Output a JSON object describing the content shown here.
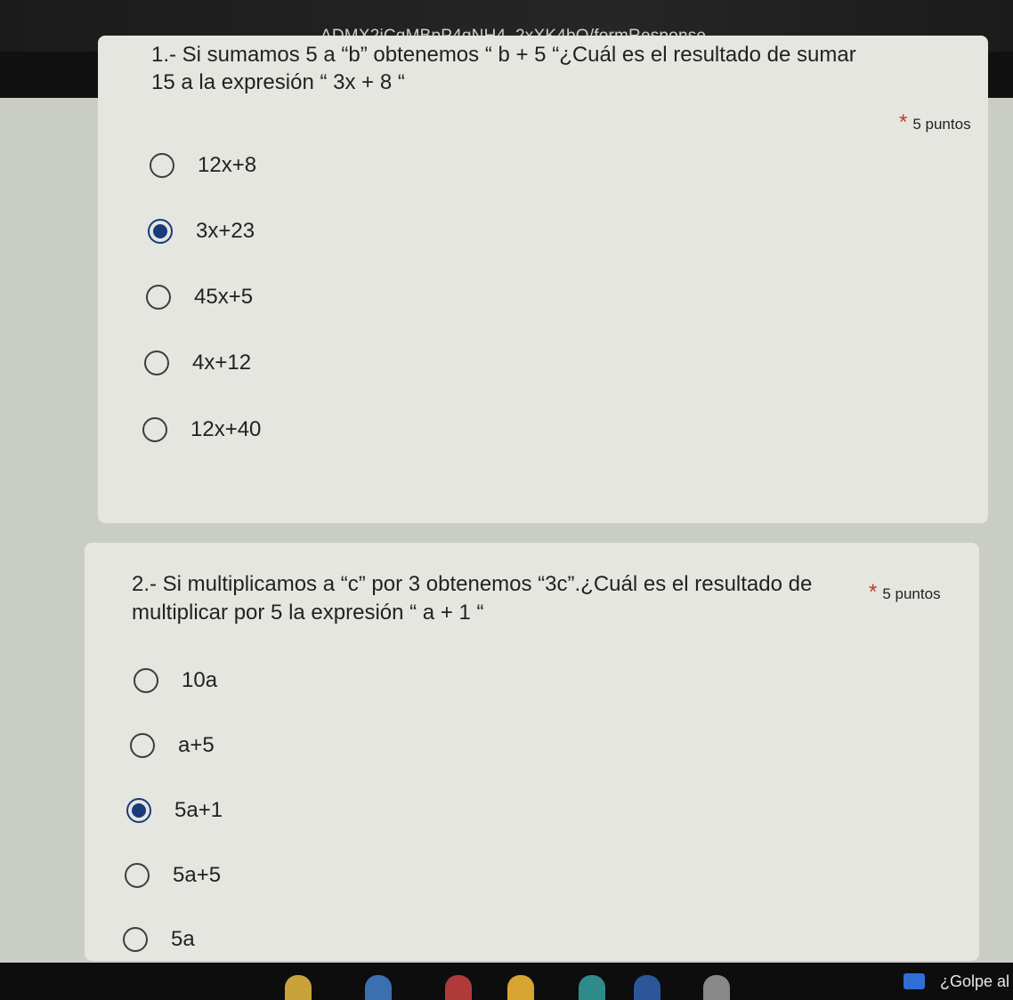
{
  "browser": {
    "url_fragment": "ADMX2iCqMBpP4qNH4_2xXK4bQ/formResponse"
  },
  "question1": {
    "line1": "1.- Si sumamos 5 a “b” obtenemos “ b + 5 “¿Cuál es el resultado de sumar",
    "line2": "15 a la expresión “ 3x + 8 “",
    "required": "*",
    "points": "5 puntos",
    "options": [
      {
        "label": "12x+8",
        "selected": false
      },
      {
        "label": "3x+23",
        "selected": true
      },
      {
        "label": "45x+5",
        "selected": false
      },
      {
        "label": "4x+12",
        "selected": false
      },
      {
        "label": "12x+40",
        "selected": false
      }
    ]
  },
  "question2": {
    "line1": "2.- Si multiplicamos a “c” por 3 obtenemos “3c”.¿Cuál es el resultado de",
    "line2": "multiplicar por 5 la expresión “ a + 1 “",
    "required": "*",
    "points": "5 puntos",
    "options": [
      {
        "label": "10a",
        "selected": false
      },
      {
        "label": "a+5",
        "selected": false
      },
      {
        "label": "5a+1",
        "selected": true
      },
      {
        "label": "5a+5",
        "selected": false
      },
      {
        "label": "5a",
        "selected": false
      }
    ]
  },
  "taskbar": {
    "search_hint": "¿Golpe al"
  },
  "colors": {
    "selected_radio": "#1a3a7a",
    "required_star": "#c0392b",
    "card_bg": "#e4e6df"
  }
}
